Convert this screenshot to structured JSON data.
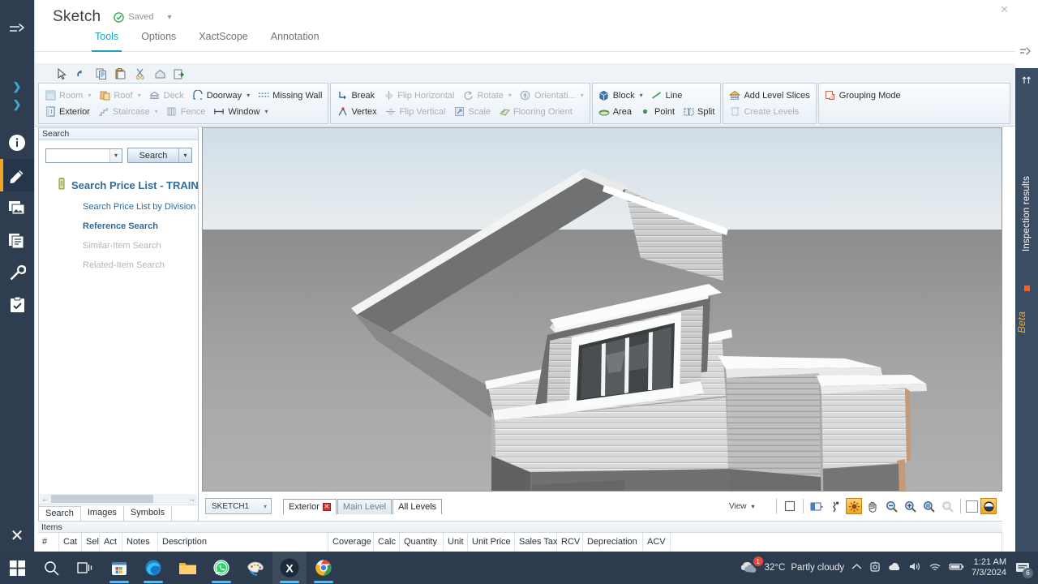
{
  "app": {
    "title": "Sketch",
    "saved_label": "Saved",
    "tabs": [
      {
        "label": "Tools",
        "active": true
      },
      {
        "label": "Options",
        "active": false
      },
      {
        "label": "XactScope",
        "active": false
      },
      {
        "label": "Annotation",
        "active": false
      }
    ]
  },
  "quick_access": [
    {
      "name": "pointer-icon"
    },
    {
      "name": "undo-icon"
    },
    {
      "name": "copy-icon"
    },
    {
      "name": "paste-icon"
    },
    {
      "name": "cut-icon"
    },
    {
      "name": "home-icon"
    },
    {
      "name": "export-icon"
    }
  ],
  "ribbon": {
    "groups": [
      {
        "name": "structure",
        "rows": [
          [
            {
              "label": "Room",
              "icon": "room-icon",
              "caret": true,
              "disabled": true
            },
            {
              "label": "Roof",
              "icon": "roof-icon",
              "caret": true,
              "disabled": true
            },
            {
              "label": "Deck",
              "icon": "deck-icon",
              "caret": false,
              "disabled": true
            },
            {
              "label": "Doorway",
              "icon": "doorway-icon",
              "caret": true,
              "disabled": false
            },
            {
              "label": "Missing Wall",
              "icon": "missing-wall-icon",
              "caret": false,
              "disabled": false
            }
          ],
          [
            {
              "label": "Exterior",
              "icon": "exterior-icon",
              "caret": false,
              "disabled": false
            },
            {
              "label": "Staircase",
              "icon": "staircase-icon",
              "caret": true,
              "disabled": true
            },
            {
              "label": "Fence",
              "icon": "fence-icon",
              "caret": false,
              "disabled": true
            },
            {
              "label": "Window",
              "icon": "window-icon",
              "caret": true,
              "disabled": false
            }
          ]
        ]
      },
      {
        "name": "modify",
        "rows": [
          [
            {
              "label": "Break",
              "icon": "break-icon",
              "caret": false,
              "disabled": false
            },
            {
              "label": "Flip Horizontal",
              "icon": "flip-horizontal-icon",
              "caret": false,
              "disabled": true
            },
            {
              "label": "Rotate",
              "icon": "rotate-icon",
              "caret": true,
              "disabled": true
            },
            {
              "label": "Orientati...",
              "icon": "orientation-icon",
              "caret": true,
              "disabled": true
            }
          ],
          [
            {
              "label": "Vertex",
              "icon": "vertex-icon",
              "caret": false,
              "disabled": false
            },
            {
              "label": "Flip Vertical",
              "icon": "flip-vertical-icon",
              "caret": false,
              "disabled": true
            },
            {
              "label": "Scale",
              "icon": "scale-icon",
              "caret": false,
              "disabled": true
            },
            {
              "label": "Flooring Orient",
              "icon": "flooring-orientation-icon",
              "caret": false,
              "disabled": true
            }
          ]
        ]
      },
      {
        "name": "draw",
        "rows": [
          [
            {
              "label": "Block",
              "icon": "block-icon",
              "caret": true,
              "disabled": false
            },
            {
              "label": "Line",
              "icon": "line-icon",
              "caret": false,
              "disabled": false
            }
          ],
          [
            {
              "label": "Area",
              "icon": "area-icon",
              "caret": false,
              "disabled": false
            },
            {
              "label": "Point",
              "icon": "point-icon",
              "caret": false,
              "disabled": false
            },
            {
              "label": "Split",
              "icon": "split-icon",
              "caret": false,
              "disabled": false
            }
          ]
        ]
      },
      {
        "name": "levels",
        "rows": [
          [
            {
              "label": "Add Level Slices",
              "icon": "add-level-slices-icon",
              "caret": false,
              "disabled": false
            }
          ],
          [
            {
              "label": "Create Levels",
              "icon": "create-levels-icon",
              "caret": false,
              "disabled": true
            }
          ]
        ]
      },
      {
        "name": "grouping",
        "rows": [
          [
            {
              "label": "Grouping Mode",
              "icon": "grouping-mode-icon",
              "caret": false,
              "disabled": false
            }
          ]
        ]
      }
    ]
  },
  "search_panel": {
    "header": "Search",
    "input_value": "",
    "input_placeholder": "",
    "search_button": "Search",
    "title": "Search Price List - TRAINI",
    "links": [
      {
        "label": "Search Price List by Division",
        "disabled": false,
        "bold": false
      },
      {
        "label": "Reference Search",
        "disabled": false,
        "bold": true
      },
      {
        "label": "Similar-Item Search",
        "disabled": true,
        "bold": false
      },
      {
        "label": "Related-Item Search",
        "disabled": true,
        "bold": false
      }
    ],
    "tabs": [
      {
        "label": "Search",
        "active": true
      },
      {
        "label": "Images",
        "active": false
      },
      {
        "label": "Symbols",
        "active": false
      }
    ]
  },
  "viewport_bar": {
    "sketch_name": "SKETCH1",
    "level_tabs": [
      {
        "label": "Exterior",
        "state": "open",
        "has_close": true
      },
      {
        "label": "Main Level",
        "state": "inactive",
        "has_close": false
      },
      {
        "label": "All Levels",
        "state": "selected",
        "has_close": false
      }
    ],
    "view_label": "View",
    "tools": [
      {
        "name": "select-rect-icon",
        "active": false
      },
      {
        "name": "view-layout-icon",
        "active": false
      },
      {
        "name": "walk-icon",
        "active": false
      },
      {
        "name": "orbit-icon",
        "active": true
      },
      {
        "name": "pan-hand-icon",
        "active": false
      },
      {
        "name": "zoom-out-icon",
        "active": false
      },
      {
        "name": "zoom-in-icon",
        "active": false
      },
      {
        "name": "zoom-extents-icon",
        "active": false
      },
      {
        "name": "zoom-window-icon",
        "active": false,
        "disabled": true
      },
      {
        "name": "white-swatch-icon",
        "active": false
      },
      {
        "name": "render-ball-icon",
        "active": true
      }
    ]
  },
  "items_grid": {
    "header": "Items",
    "columns": [
      "#",
      "Cat",
      "Sel",
      "Act",
      "Notes",
      "Description",
      "Coverage",
      "Calc",
      "Quantity",
      "Unit",
      "Unit Price",
      "Sales Tax",
      "RCV",
      "Depreciation",
      "ACV"
    ]
  },
  "right_rail": {
    "label": "Inspection results",
    "beta": "Beta"
  },
  "taskbar": {
    "weather_temp": "32°C",
    "weather_desc": "Partly cloudy",
    "weather_badge": "1",
    "time": "1:21 AM",
    "date": "7/3/2024",
    "notification_count": "6",
    "apps": [
      {
        "name": "start-icon"
      },
      {
        "name": "search-icon"
      },
      {
        "name": "task-view-icon"
      },
      {
        "name": "microsoft-store-icon"
      },
      {
        "name": "edge-icon"
      },
      {
        "name": "file-explorer-icon"
      },
      {
        "name": "whatsapp-icon"
      },
      {
        "name": "paint-icon"
      },
      {
        "name": "xactimate-icon"
      },
      {
        "name": "chrome-icon"
      }
    ]
  },
  "left_rail": {
    "items": [
      {
        "name": "collapse-icon"
      },
      {
        "name": "chevron-right-icon-1"
      },
      {
        "name": "chevron-right-icon-2"
      },
      {
        "name": "info-icon"
      },
      {
        "name": "sketch-pencil-icon"
      },
      {
        "name": "photos-icon"
      },
      {
        "name": "documents-icon"
      },
      {
        "name": "tools-wrench-icon"
      },
      {
        "name": "checklist-icon"
      }
    ],
    "close_label": "✕"
  },
  "colors": {
    "accent": "#1da1c4",
    "rail_bg": "#2e3e50",
    "highlight_orange": "#f0a52a",
    "beta_orange": "#f0a52a"
  }
}
